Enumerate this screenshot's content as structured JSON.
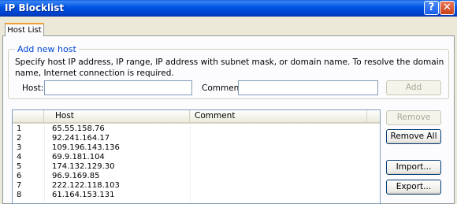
{
  "window": {
    "title": "IP Blocklist"
  },
  "tabs": [
    {
      "label": "Host List"
    }
  ],
  "add_group": {
    "legend": "Add new host",
    "description": "Specify host IP address, IP range, IP address with subnet mask, or domain name. To resolve the domain name, Internet connection is required.",
    "host_label": "Host:",
    "host_value": "",
    "comment_label": "Comment:",
    "comment_value": "",
    "add_label": "Add"
  },
  "table": {
    "columns": [
      "",
      "Host",
      "Comment"
    ],
    "rows": [
      {
        "num": "1",
        "host": "65.55.158.76",
        "comment": ""
      },
      {
        "num": "2",
        "host": "92.241.164.17",
        "comment": ""
      },
      {
        "num": "3",
        "host": "109.196.143.136",
        "comment": ""
      },
      {
        "num": "4",
        "host": "69.9.181.104",
        "comment": ""
      },
      {
        "num": "5",
        "host": "174.132.129.30",
        "comment": ""
      },
      {
        "num": "6",
        "host": "96.9.169.85",
        "comment": ""
      },
      {
        "num": "7",
        "host": "222.122.118.103",
        "comment": ""
      },
      {
        "num": "8",
        "host": "61.164.153.131",
        "comment": ""
      }
    ]
  },
  "buttons": {
    "remove": "Remove",
    "remove_all": "Remove All",
    "import": "Import...",
    "export": "Export..."
  },
  "colors": {
    "title_bar": "#0055e5",
    "tab_accent": "#f0a030",
    "legend": "#0046d5"
  },
  "icons": {
    "help": "question-mark",
    "close": "x-mark"
  }
}
